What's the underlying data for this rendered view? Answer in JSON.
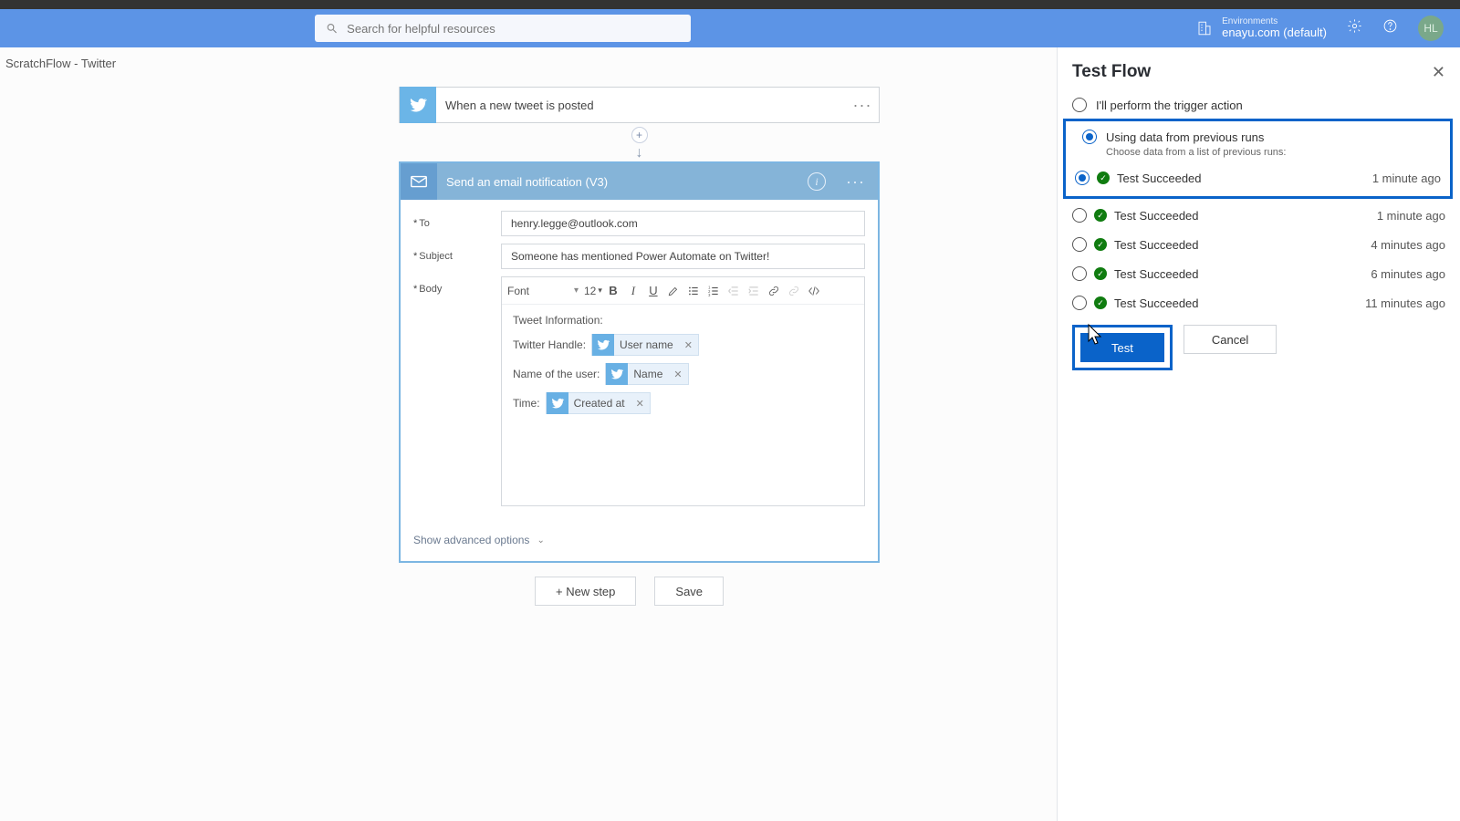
{
  "appbar": {
    "search_placeholder": "Search for helpful resources",
    "env_label": "Environments",
    "env_value": "enayu.com (default)",
    "avatar_initials": "HL"
  },
  "breadcrumb": "ScratchFlow - Twitter",
  "trigger": {
    "title": "When a new tweet is posted"
  },
  "action": {
    "title": "Send an email notification (V3)",
    "labels": {
      "to": "To",
      "subject": "Subject",
      "body": "Body"
    },
    "to_value": "henry.legge@outlook.com",
    "subject_value": "Someone has mentioned Power Automate on Twitter!",
    "rte": {
      "font_label": "Font",
      "size_label": "12",
      "body_heading": "Tweet Information:",
      "line1_label": "Twitter Handle:",
      "line2_label": "Name of the user:",
      "line3_label": "Time:",
      "token_username": "User name",
      "token_name": "Name",
      "token_createdat": "Created at"
    },
    "advanced": "Show advanced options"
  },
  "bottom": {
    "new_step": "+ New step",
    "save": "Save"
  },
  "panel": {
    "title": "Test Flow",
    "opt_manual": "I'll perform the trigger action",
    "opt_previous": "Using data from previous runs",
    "opt_previous_sub": "Choose data from a list of previous runs:",
    "runs": [
      {
        "label": "Test Succeeded",
        "time": "1 minute ago",
        "selected": true
      },
      {
        "label": "Test Succeeded",
        "time": "1 minute ago",
        "selected": false
      },
      {
        "label": "Test Succeeded",
        "time": "4 minutes ago",
        "selected": false
      },
      {
        "label": "Test Succeeded",
        "time": "6 minutes ago",
        "selected": false
      },
      {
        "label": "Test Succeeded",
        "time": "11 minutes ago",
        "selected": false
      }
    ],
    "test_btn": "Test",
    "cancel_btn": "Cancel"
  }
}
